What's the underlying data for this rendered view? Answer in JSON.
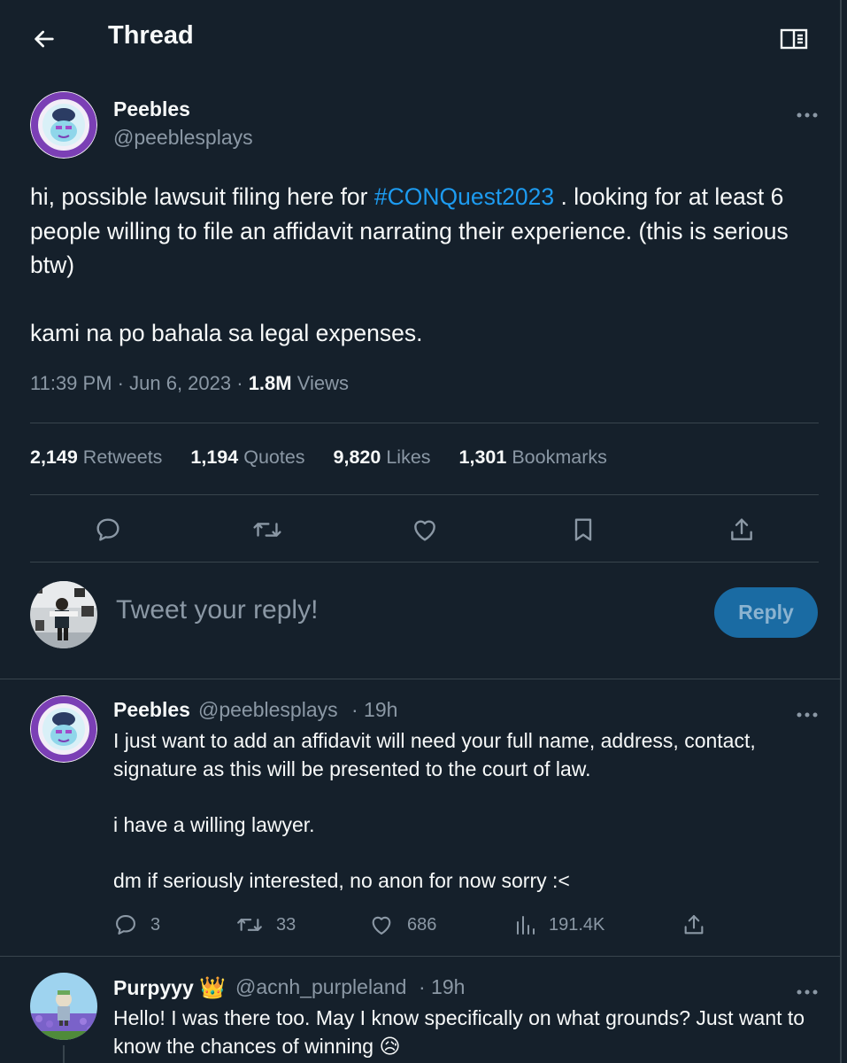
{
  "header": {
    "title": "Thread"
  },
  "main_tweet": {
    "author_name": "Peebles",
    "author_handle": "@peeblesplays",
    "text_part1": "hi, possible lawsuit filing here for ",
    "hashtag": "#CONQuest2023",
    "text_part2": " . looking for at least 6 people willing to file an affidavit narrating their experience. (this is serious btw)",
    "text_para2": "kami na po bahala sa legal expenses.",
    "time": "11:39 PM",
    "date": "Jun 6, 2023",
    "views_count": "1.8M",
    "views_label": "Views",
    "stats": [
      {
        "num": "2,149",
        "label": "Retweets"
      },
      {
        "num": "1,194",
        "label": "Quotes"
      },
      {
        "num": "9,820",
        "label": "Likes"
      },
      {
        "num": "1,301",
        "label": "Bookmarks"
      }
    ]
  },
  "reply_box": {
    "placeholder": "Tweet your reply!",
    "button": "Reply"
  },
  "replies": [
    {
      "author_name": "Peebles",
      "author_handle": "@peeblesplays",
      "time": "· 19h",
      "paragraphs": [
        "I just want to add an affidavit will need your full name, address, contact, signature as this will be presented to the court of law.",
        "i have a willing lawyer.",
        "dm if seriously interested, no anon for now sorry :<"
      ],
      "reply_count": "3",
      "retweet_count": "33",
      "like_count": "686",
      "view_count": "191.4K"
    },
    {
      "author_name": "Purpyyy",
      "author_badge": "👑",
      "author_handle": "@acnh_purpleland",
      "time": "· 19h",
      "text": "Hello! I was there too. May I know specifically on what grounds? Just want to know the chances of winning",
      "emoji": "😥"
    }
  ],
  "icons": {
    "back": "arrow-left-icon",
    "reader": "book-open-icon",
    "more": "more-dots-icon",
    "reply": "speech-bubble-icon",
    "retweet": "retweet-icon",
    "like": "heart-icon",
    "bookmark": "bookmark-icon",
    "share": "share-upload-icon",
    "views": "bar-chart-icon"
  },
  "colors": {
    "background": "#15202b",
    "accent": "#1d9bf0",
    "muted": "#8b98a5",
    "divider": "#38444d"
  }
}
